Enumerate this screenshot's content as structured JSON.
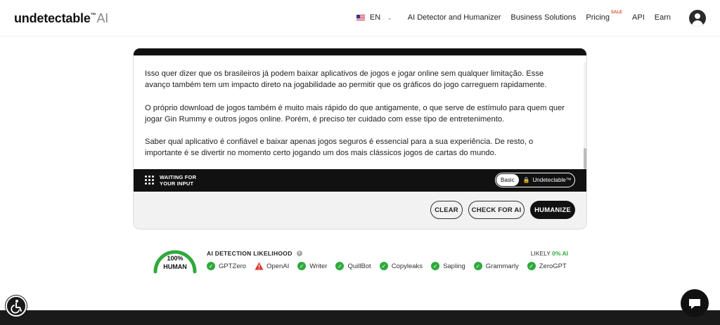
{
  "header": {
    "logo_main": "undetectable",
    "logo_tm": "™",
    "logo_ai": "AI",
    "language": "EN",
    "nav": {
      "detector": "AI Detector and Humanizer",
      "business": "Business Solutions",
      "pricing": "Pricing",
      "pricing_badge": "SALE",
      "api": "API",
      "earn": "Earn"
    }
  },
  "editor": {
    "paragraphs": [
      "Isso quer dizer que os brasileiros já podem baixar aplicativos de jogos e jogar online sem qualquer limitação. Esse avanço também tem um impacto direto na jogabilidade ao permitir que os gráficos do jogo carreguem rapidamente.",
      "O próprio download de jogos também é muito mais rápido do que antigamente, o que serve de estímulo para quem quer jogar Gin Rummy e outros jogos online. Porém, é preciso ter cuidado com esse tipo de entretenimento.",
      "Saber qual aplicativo é confiável e baixar apenas jogos seguros é essencial para a sua experiência. De resto, o importante é se divertir no momento certo jogando um dos mais clássicos jogos de cartas do mundo."
    ],
    "status": "WAITING FOR YOUR INPUT",
    "mode_basic": "Basic",
    "mode_undetectable": "Undetectable™",
    "buttons": {
      "clear": "CLEAR",
      "check": "CHECK FOR AI",
      "humanize": "HUMANIZE"
    }
  },
  "detection": {
    "gauge_pct": "100%",
    "gauge_label": "HUMAN",
    "gauge_value": 1.0,
    "title": "AI DETECTION LIKELIHOOD",
    "likely_prefix": "LIKELY",
    "likely_value": "0% AI",
    "detectors": [
      {
        "name": "GPTZero",
        "status": "pass"
      },
      {
        "name": "OpenAI",
        "status": "warn"
      },
      {
        "name": "Writer",
        "status": "pass"
      },
      {
        "name": "QuillBot",
        "status": "pass"
      },
      {
        "name": "Copyleaks",
        "status": "pass"
      },
      {
        "name": "Sapling",
        "status": "pass"
      },
      {
        "name": "Grammarly",
        "status": "pass"
      },
      {
        "name": "ZeroGPT",
        "status": "pass"
      }
    ]
  },
  "colors": {
    "accent_green": "#2eaa3c",
    "warn_red": "#d93a2b",
    "sale_orange": "#d4502a",
    "dark": "#111111"
  }
}
